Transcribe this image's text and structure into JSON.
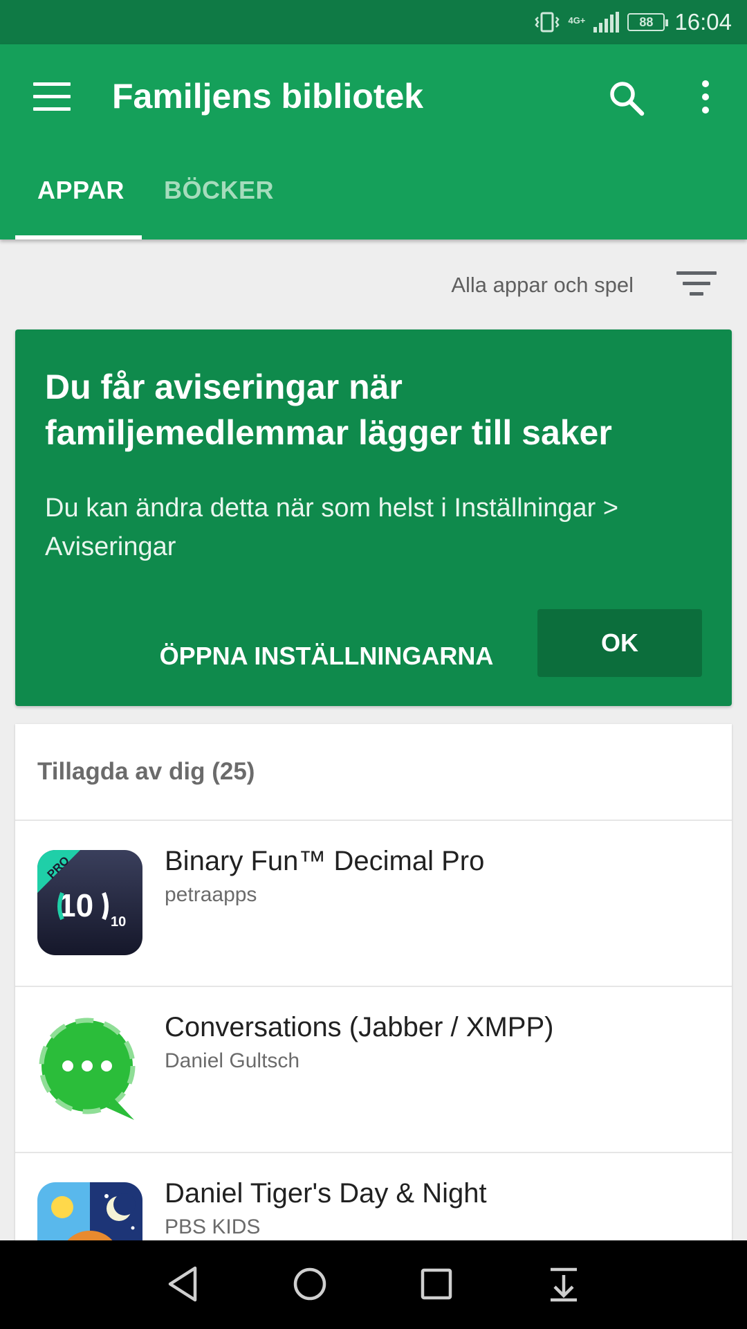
{
  "status_bar": {
    "time": "16:04",
    "network": "4G+",
    "battery": "88",
    "icons": [
      "vibrate-icon",
      "signal-icon",
      "battery-icon"
    ]
  },
  "app_bar": {
    "title": "Familjens bibliotek",
    "icons": [
      "menu-icon",
      "search-icon",
      "more-options-icon"
    ],
    "tabs": [
      {
        "label": "APPAR",
        "selected": true
      },
      {
        "label": "BÖCKER",
        "selected": false
      }
    ]
  },
  "filter": {
    "label": "Alla appar och spel",
    "icon": "filter-icon"
  },
  "notice": {
    "title": "Du får aviseringar när familjemedlemmar lägger till saker",
    "body": "Du kan ändra detta när som helst i Inställningar > Aviseringar",
    "open_settings_label": "ÖPPNA INSTÄLLNINGARNA",
    "ok_label": "OK"
  },
  "list": {
    "header": "Tillagda av dig (25)",
    "items": [
      {
        "name": "Binary Fun™ Decimal Pro",
        "developer": "petraapps",
        "icon": "binary-fun-app-icon",
        "icon_text": "10",
        "icon_badge": "PRO"
      },
      {
        "name": "Conversations (Jabber / XMPP)",
        "developer": "Daniel Gultsch",
        "icon": "conversations-app-icon"
      },
      {
        "name": "Daniel Tiger's Day & Night",
        "developer": "PBS KIDS",
        "icon": "daniel-tiger-app-icon"
      }
    ]
  },
  "nav_bar": {
    "icons": [
      "back-icon",
      "home-icon",
      "recents-icon",
      "notification-pull-icon"
    ]
  },
  "colors": {
    "primary": "#15a05a",
    "status_bar": "#0f7a45",
    "notice_bg": "#0f8a4c",
    "ok_button": "#0c6e3c"
  }
}
